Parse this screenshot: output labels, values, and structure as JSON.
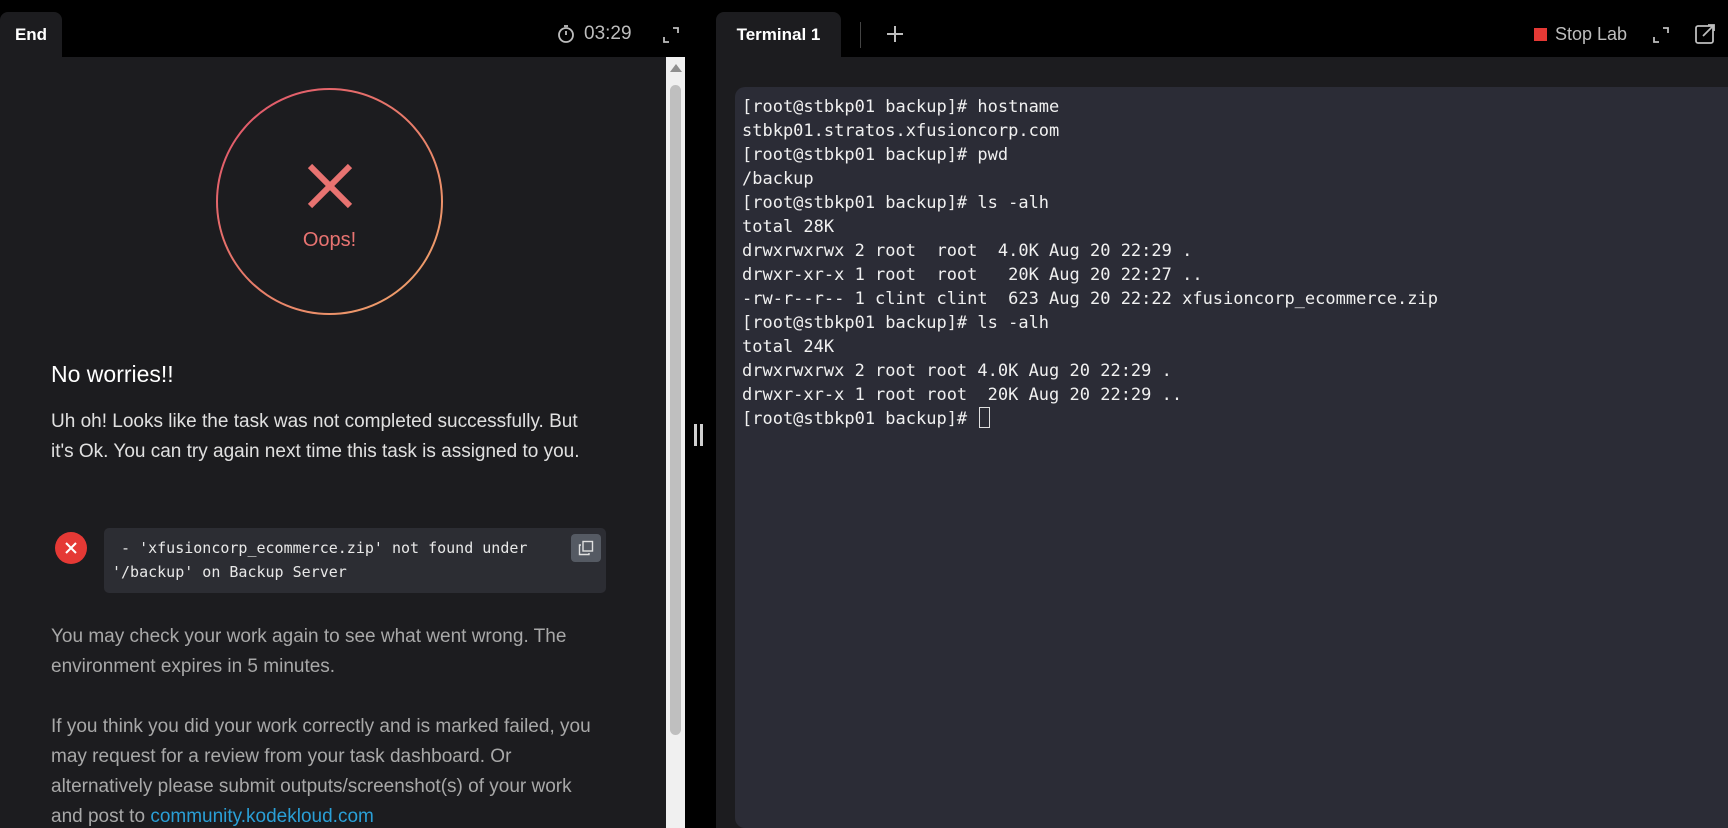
{
  "left_header": {
    "tab_label": "End",
    "timer": "03:29"
  },
  "result": {
    "status_label": "Oops!",
    "heading": "No worries!!",
    "message": "Uh oh! Looks like the task was not completed successfully. But it's Ok. You can try again next time this task is assigned to you.",
    "error_line1": " - 'xfusioncorp_ecommerce.zip' not found under",
    "error_line2": "'/backup' on Backup Server",
    "check_text": "You may check your work again to see what went wrong. The environment expires in 5 minutes.",
    "review_text": "If you think you did your work correctly and is marked failed, you may request for a review from your task dashboard. Or alternatively please submit outputs/screenshot(s) of your work and post to",
    "community_link": "community.kodekloud.com"
  },
  "right_header": {
    "tab_label": "Terminal 1",
    "stop_label": "Stop Lab"
  },
  "terminal": {
    "lines": [
      "[root@stbkp01 backup]# hostname",
      "stbkp01.stratos.xfusioncorp.com",
      "[root@stbkp01 backup]# pwd",
      "/backup",
      "[root@stbkp01 backup]# ls -alh",
      "total 28K",
      "drwxrwxrwx 2 root  root  4.0K Aug 20 22:29 .",
      "drwxr-xr-x 1 root  root   20K Aug 20 22:27 ..",
      "-rw-r--r-- 1 clint clint  623 Aug 20 22:22 xfusioncorp_ecommerce.zip",
      "[root@stbkp01 backup]# ls -alh",
      "total 24K",
      "drwxrwxrwx 2 root root 4.0K Aug 20 22:29 .",
      "drwxr-xr-x 1 root root  20K Aug 20 22:29 .."
    ],
    "prompt": "[root@stbkp01 backup]# "
  },
  "colors": {
    "error_red": "#e53935",
    "oops_text": "#e87371",
    "link_blue": "#2a9fd6",
    "terminal_bg": "#2b2c36"
  }
}
